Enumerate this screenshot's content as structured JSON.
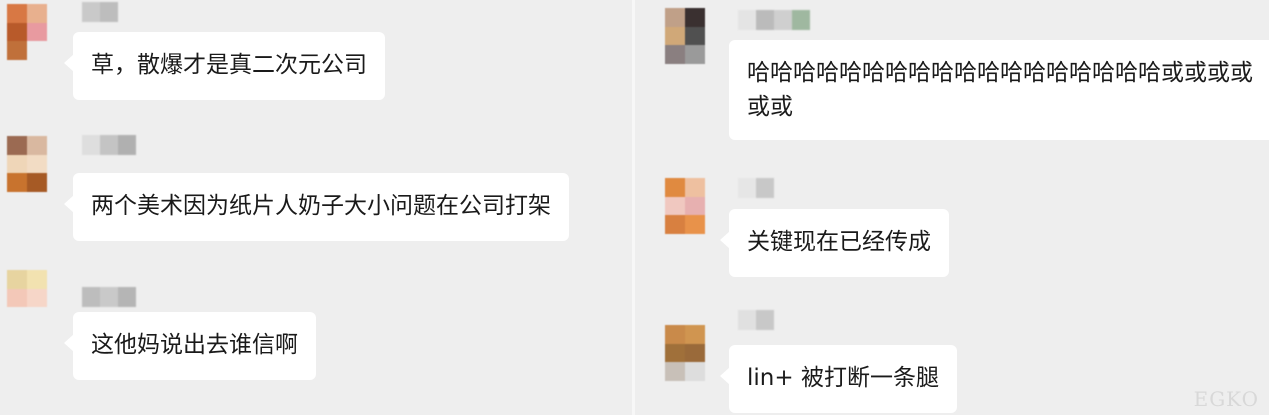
{
  "chat": {
    "left": [
      {
        "text": "草，散爆才是真二次元公司",
        "avatar_colors": [
          "#d87844",
          "#e8b08e",
          "#b85a2a",
          "#e89aa0",
          "#c0703a",
          "#eee"
        ],
        "name_colors": [
          "#c9c9c9",
          "#bdbdbd"
        ]
      },
      {
        "text": "两个美术因为纸片人奶子大小问题在公司打架",
        "avatar_colors": [
          "#9b6a52",
          "#d9b8a0",
          "#efd6b8",
          "#f2dcc4",
          "#c8732e",
          "#a65a25"
        ],
        "name_colors": [
          "#dedede",
          "#c4c4c4",
          "#b0b0b0"
        ]
      },
      {
        "text": "这他妈说出去谁信啊",
        "avatar_colors": [
          "#e7d4a0",
          "#f2e2b0",
          "#f3c8b8",
          "#f6d6c8",
          "#eee",
          "#eee"
        ],
        "name_colors": [
          "#bdbdbd",
          "#c9c9c9",
          "#b5b5b5"
        ]
      }
    ],
    "right": [
      {
        "text": "哈哈哈哈哈哈哈哈哈哈哈哈哈哈哈哈哈哈或或或或或或",
        "avatar_colors": [
          "#c0a088",
          "#3a3030",
          "#d0a878",
          "#505050",
          "#8a7f80",
          "#9a9a9a"
        ],
        "name_colors": [
          "#e4e4e4",
          "#bbbbbb",
          "#cfcfcf",
          "#9fb8a0"
        ]
      },
      {
        "text": "关键现在已经传成",
        "avatar_colors": [
          "#e08a40",
          "#eec0a0",
          "#f0c8c0",
          "#e7b0b0",
          "#d88040",
          "#e8924a"
        ],
        "name_colors": [
          "#e6e6e6",
          "#c8c8c8"
        ]
      },
      {
        "text": "lin+ 被打断一条腿",
        "avatar_colors": [
          "#c98a4a",
          "#d09550",
          "#a0703a",
          "#9a6a3a",
          "#c8c0b8",
          "#ddd"
        ],
        "name_colors": [
          "#e0e0e0",
          "#c8c8c8"
        ]
      }
    ]
  },
  "watermark": "EGKO"
}
